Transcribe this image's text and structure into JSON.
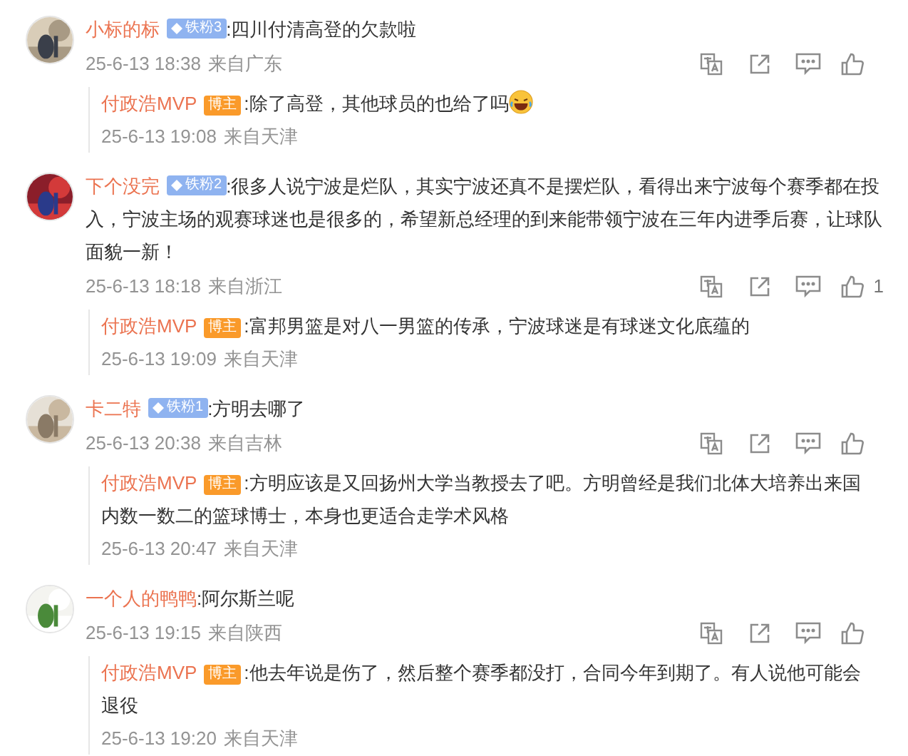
{
  "comments": [
    {
      "user": "小标的标",
      "fan_badge": "铁粉3",
      "text": ":四川付清高登的欠款啦",
      "time": "25-6-13 18:38",
      "location": "来自广东",
      "reply": {
        "user": "付政浩MVP",
        "badge": "博主",
        "text": ":除了高登，其他球员的也给了吗",
        "emoji": true,
        "time": "25-6-13 19:08",
        "location": "来自天津"
      }
    },
    {
      "user": "下个没完",
      "fan_badge": "铁粉2",
      "text": ":很多人说宁波是烂队，其实宁波还真不是摆烂队，看得出来宁波每个赛季都在投入，宁波主场的观赛球迷也是很多的，希望新总经理的到来能带领宁波在三年内进季后赛，让球队面貌一新！",
      "time": "25-6-13 18:18",
      "location": "来自浙江",
      "likes": "1",
      "reply": {
        "user": "付政浩MVP",
        "badge": "博主",
        "text": ":富邦男篮是对八一男篮的传承，宁波球迷是有球迷文化底蕴的",
        "emoji": false,
        "time": "25-6-13 19:09",
        "location": "来自天津"
      }
    },
    {
      "user": "卡二特",
      "fan_badge": "铁粉1",
      "text": ":方明去哪了",
      "time": "25-6-13 20:38",
      "location": "来自吉林",
      "reply": {
        "user": "付政浩MVP",
        "badge": "博主",
        "text": ":方明应该是又回扬州大学当教授去了吧。方明曾经是我们北体大培养出来国内数一数二的篮球博士，本身也更适合走学术风格",
        "emoji": false,
        "time": "25-6-13 20:47",
        "location": "来自天津"
      }
    },
    {
      "user": "一个人的鸭鸭",
      "text": ":阿尔斯兰呢",
      "time": "25-6-13 19:15",
      "location": "来自陕西",
      "reply": {
        "user": "付政浩MVP",
        "badge": "博主",
        "text": ":他去年说是伤了，然后整个赛季都没打，合同今年到期了。有人说他可能会退役",
        "emoji": false,
        "time": "25-6-13 19:20",
        "location": "来自天津"
      }
    }
  ]
}
